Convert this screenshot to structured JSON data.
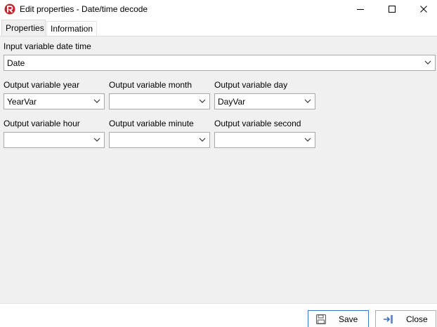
{
  "window": {
    "title": "Edit properties - Date/time decode",
    "app_icon": "app-logo-icon",
    "controls": [
      "minimize-icon",
      "maximize-icon",
      "close-icon"
    ]
  },
  "tabs": [
    {
      "label": "Properties",
      "active": true
    },
    {
      "label": "Information",
      "active": false
    }
  ],
  "form": {
    "input_datetime": {
      "label": "Input variable date time",
      "value": "Date"
    },
    "year": {
      "label": "Output variable year",
      "value": "YearVar"
    },
    "month": {
      "label": "Output variable month",
      "value": ""
    },
    "day": {
      "label": "Output variable day",
      "value": "DayVar"
    },
    "hour": {
      "label": "Output variable hour",
      "value": ""
    },
    "minute": {
      "label": "Output variable minute",
      "value": ""
    },
    "second": {
      "label": "Output variable second",
      "value": ""
    }
  },
  "buttons": {
    "save": {
      "label": "Save",
      "icon": "floppy-disk-icon"
    },
    "close": {
      "label": "Close",
      "icon": "exit-arrow-icon"
    }
  },
  "colors": {
    "accent": "#3c78c8",
    "panel_bg": "#f0f0f0",
    "app_icon_red": "#c0282d"
  }
}
